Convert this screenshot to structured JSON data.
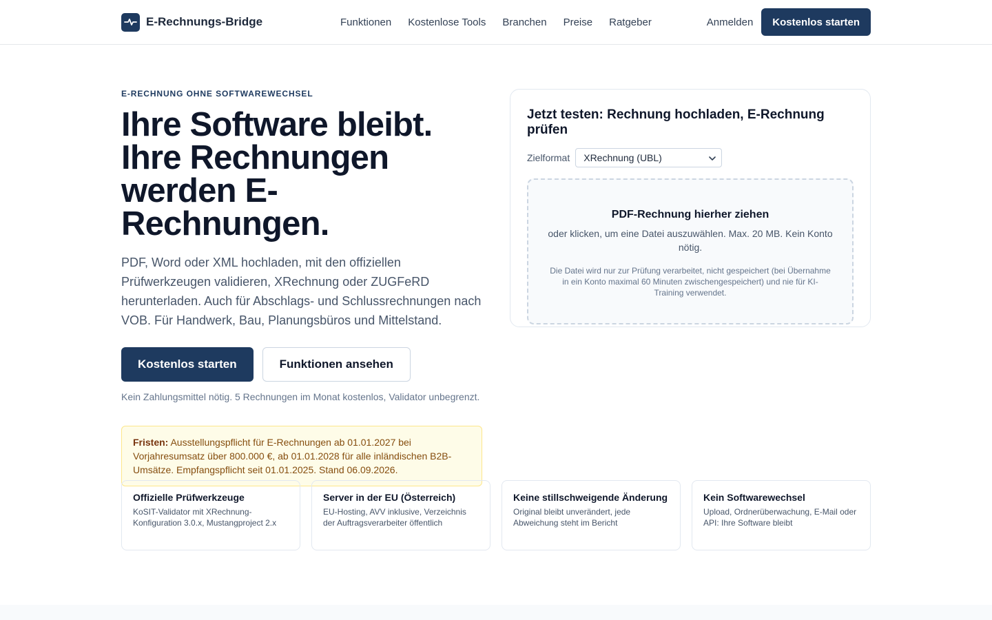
{
  "header": {
    "brand": "E-Rechnungs-Bridge",
    "nav": [
      "Funktionen",
      "Kostenlose Tools",
      "Branchen",
      "Preise",
      "Ratgeber"
    ],
    "login": "Anmelden",
    "cta": "Kostenlos starten"
  },
  "hero": {
    "eyebrow": "E-Rechnung ohne Softwarewechsel",
    "headline": [
      "Ihre Software bleibt.",
      "Ihre Rechnungen",
      "werden E-Rechnungen."
    ],
    "lead": "PDF, Word oder XML hochladen, mit den offiziellen Prüfwerkzeugen validieren, XRechnung oder ZUGFeRD herunterladen. Auch für Abschlags- und Schlussrechnungen nach VOB. Für Handwerk, Bau, Planungsbüros und Mittelstand.",
    "primary_cta": "Kostenlos starten",
    "secondary_cta": "Funktionen ansehen",
    "note": "Kein Zahlungsmittel nötig. 5 Rechnungen im Monat kostenlos, Validator unbegrenzt.",
    "deadline_label": "Fristen:",
    "deadline_text": " Ausstellungspflicht für E-Rechnungen ab 01.01.2027 bei Vorjahresumsatz über 800.000 €, ab 01.01.2028 für alle inländischen B2B-Umsätze. Empfangspflicht seit 01.01.2025. Stand 06.09.2026."
  },
  "upload": {
    "title": "Jetzt testen: Rechnung hochladen, E-Rechnung prüfen",
    "format_label": "Zielformat",
    "format_value": "XRechnung (UBL)",
    "drop_title": "PDF-Rechnung hierher ziehen",
    "drop_sub": "oder klicken, um eine Datei auszuwählen. Max. 20 MB. Kein Konto nötig.",
    "privacy": "Die Datei wird nur zur Prüfung verarbeitet, nicht gespeichert (bei Übernahme in ein Konto maximal 60 Minuten zwischengespeichert) und nie für KI-Training verwendet."
  },
  "features": [
    {
      "title": "Offizielle Prüfwerkzeuge",
      "text": "KoSIT-Validator mit XRechnung-Konfiguration 3.0.x, Mustangproject 2.x"
    },
    {
      "title": "Server in der EU (Österreich)",
      "text": "EU-Hosting, AVV inklusive, Verzeichnis der Auftragsverarbeiter öffentlich"
    },
    {
      "title": "Keine stillschweigende Änderung",
      "text": "Original bleibt unverändert, jede Abweichung steht im Bericht"
    },
    {
      "title": "Kein Softwarewechsel",
      "text": "Upload, Ordnerüberwachung, E-Mail oder API: Ihre Software bleibt"
    }
  ],
  "colors": {
    "brand": "#1e3a5f",
    "deadline_bg": "#fefce8",
    "deadline_text": "#854d0e"
  },
  "icons": {
    "brand_logo": "pulse-icon",
    "select_arrow": "chevron-down-icon"
  }
}
